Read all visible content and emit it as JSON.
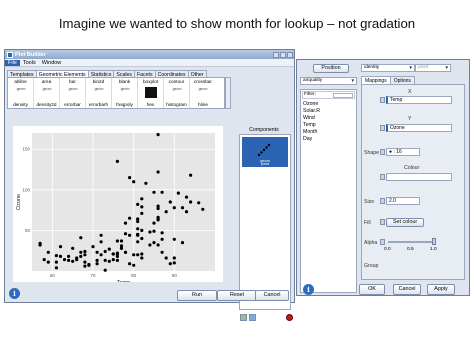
{
  "slide": {
    "title": "Imagine we wanted to show month for lookup – not gradation"
  },
  "plot_builder": {
    "title": "Plot Builder",
    "menu": [
      "File",
      "Tools",
      "Window"
    ],
    "tabs": [
      "Templates",
      "Geometric Elements",
      "Statistics",
      "Scales",
      "Facets",
      "Coordinates",
      "Other"
    ],
    "active_tab": "Geometric Elements",
    "geoms_top": [
      "abline",
      "area",
      "bar",
      "bin2d",
      "blank",
      "boxplot",
      "contour",
      "crossbar"
    ],
    "geoms_bottom": [
      "density",
      "density2d",
      "errorbar",
      "errorbarh",
      "freqpoly",
      "hex",
      "histogram",
      "hline"
    ],
    "geom_icon_text": "geom",
    "components_label": "Components",
    "component_item": {
      "line1": "geom",
      "line2": "point"
    },
    "buttons": {
      "run": "Run",
      "reset": "Reset",
      "cancel": "Cancel"
    }
  },
  "chart_data": {
    "type": "scatter",
    "xlabel": "Temp",
    "ylabel": "Ozone",
    "xlim": [
      55,
      100
    ],
    "ylim": [
      0,
      170
    ],
    "xticks": [
      60,
      70,
      80,
      90
    ],
    "yticks": [
      50,
      100,
      150
    ],
    "x": [
      67,
      72,
      74,
      62,
      65,
      59,
      61,
      69,
      66,
      68,
      58,
      64,
      66,
      57,
      68,
      62,
      59,
      73,
      61,
      61,
      57,
      67,
      81,
      79,
      76,
      82,
      90,
      87,
      82,
      77,
      72,
      65,
      73,
      76,
      85,
      86,
      81,
      82,
      86,
      85,
      87,
      89,
      90,
      74,
      80,
      84,
      85,
      81,
      82,
      86,
      88,
      86,
      83,
      81,
      81,
      81,
      82,
      86,
      85,
      87,
      89,
      90,
      90,
      92,
      86,
      86,
      82,
      80,
      79,
      77,
      79,
      76,
      78,
      78,
      77,
      72,
      75,
      79,
      81,
      86,
      88,
      97,
      94,
      96,
      94,
      91,
      92,
      93,
      93,
      87,
      84,
      80,
      78,
      75,
      73,
      81,
      76,
      77,
      71,
      71,
      78,
      67,
      76,
      68,
      82,
      64,
      71,
      81,
      69,
      63,
      70,
      75,
      76,
      68
    ],
    "y": [
      41,
      36,
      12,
      18,
      28,
      23,
      19,
      8,
      16,
      11,
      14,
      18,
      14,
      34,
      6,
      30,
      11,
      1,
      11,
      4,
      32,
      23,
      45,
      115,
      37,
      71,
      39,
      23,
      21,
      37,
      20,
      12,
      13,
      135,
      49,
      32,
      64,
      40,
      77,
      97,
      97,
      85,
      10,
      27,
      7,
      48,
      35,
      61,
      79,
      63,
      16,
      80,
      108,
      20,
      52,
      82,
      50,
      64,
      59,
      39,
      9,
      16,
      78,
      35,
      66,
      122,
      89,
      110,
      44,
      28,
      65,
      22,
      59,
      23,
      31,
      44,
      21,
      9,
      45,
      168,
      73,
      76,
      118,
      84,
      85,
      96,
      78,
      73,
      91,
      47,
      32,
      20,
      23,
      21,
      24,
      44,
      21,
      28,
      9,
      13,
      46,
      18,
      13,
      24,
      16,
      13,
      23,
      36,
      7,
      14,
      30,
      14,
      18,
      20
    ],
    "colors": {
      "point": "#000000",
      "panel": "#e6e6e6",
      "grid": "#ffffff"
    }
  },
  "properties": {
    "top_buttons": {
      "position": "Position",
      "identity": "identity",
      "point": "point"
    },
    "dataset": "airquality",
    "tabs": [
      "Mappings",
      "Options"
    ],
    "active_tab": "Mappings",
    "filter_label": "Filter:",
    "variables": [
      "Ozone",
      "Solar.R",
      "Wind",
      "Temp",
      "Month",
      "Day"
    ],
    "mappings": {
      "x_label": "X",
      "x_value": "Temp",
      "y_label": "Y",
      "y_value": "Ozone",
      "shape_label": "Shape",
      "shape_value": ": 16",
      "colour_label": "Colour",
      "colour_value": "",
      "size_label": "Size",
      "size_value": "2.0",
      "fill_label": "Fill",
      "fill_button": "Set colour",
      "alpha_label": "Alpha",
      "alpha_ticks": [
        "0.0",
        "0.5",
        "1.0"
      ],
      "alpha_value": 1.0,
      "group_label": "Group"
    },
    "buttons": {
      "ok": "OK",
      "cancel": "Cancel",
      "apply": "Apply"
    }
  }
}
